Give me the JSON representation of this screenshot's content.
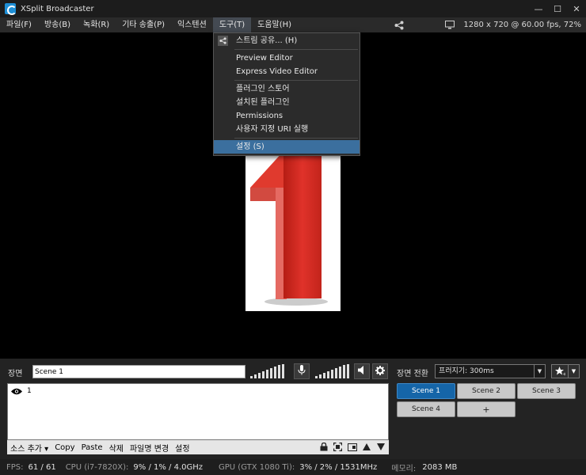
{
  "window": {
    "title": "XSplit Broadcaster",
    "minimize": "—",
    "maximize": "☐",
    "close": "✕"
  },
  "menubar": {
    "items": [
      "파일(F)",
      "방송(B)",
      "녹화(R)",
      "기타 송출(P)",
      "익스텐션",
      "도구(T)",
      "도움말(H)"
    ],
    "active_item": "도구(T)",
    "resolution": "1280 x 720 @ 60.00 fps, 72%"
  },
  "tools_menu": {
    "share_stream": "스트림 공유... (H)",
    "preview_editor": "Preview Editor",
    "express_video_editor": "Express Video Editor",
    "plugin_store": "플러그인 스토어",
    "installed_plugins": "설치된 플러그인",
    "permissions": "Permissions",
    "run_custom_uri": "사용자 지정 URI 실행",
    "settings": "설정 (S)"
  },
  "scene_panel": {
    "label": "장면",
    "scene_name": "Scene 1",
    "sources": [
      {
        "name": "1",
        "visible": true
      }
    ]
  },
  "source_toolbar": {
    "add_source": "소스 추가",
    "copy": "Copy",
    "paste": "Paste",
    "delete": "삭제",
    "rename": "파일명 변경",
    "settings": "설정"
  },
  "transition": {
    "label": "장면 전환",
    "value": "프러지기: 300ms"
  },
  "scenes": [
    {
      "label": "Scene 1",
      "active": true
    },
    {
      "label": "Scene 2",
      "active": false
    },
    {
      "label": "Scene 3",
      "active": false
    },
    {
      "label": "Scene 4",
      "active": false
    },
    {
      "label": "+",
      "active": false
    }
  ],
  "statusbar": {
    "fps_label": "FPS:",
    "fps_value": "61 / 61",
    "cpu_label": "CPU (i7-7820X):",
    "cpu_value": "9% / 1% / 4.0GHz",
    "gpu_label": "GPU (GTX 1080 Ti):",
    "gpu_value": "3% / 2% / 1531MHz",
    "mem_label": "메모리:",
    "mem_value": "2083 MB"
  },
  "colors": {
    "accent": "#1565a8",
    "menu_highlight": "#3b6f9e",
    "preview_red": "#d42a1e"
  }
}
